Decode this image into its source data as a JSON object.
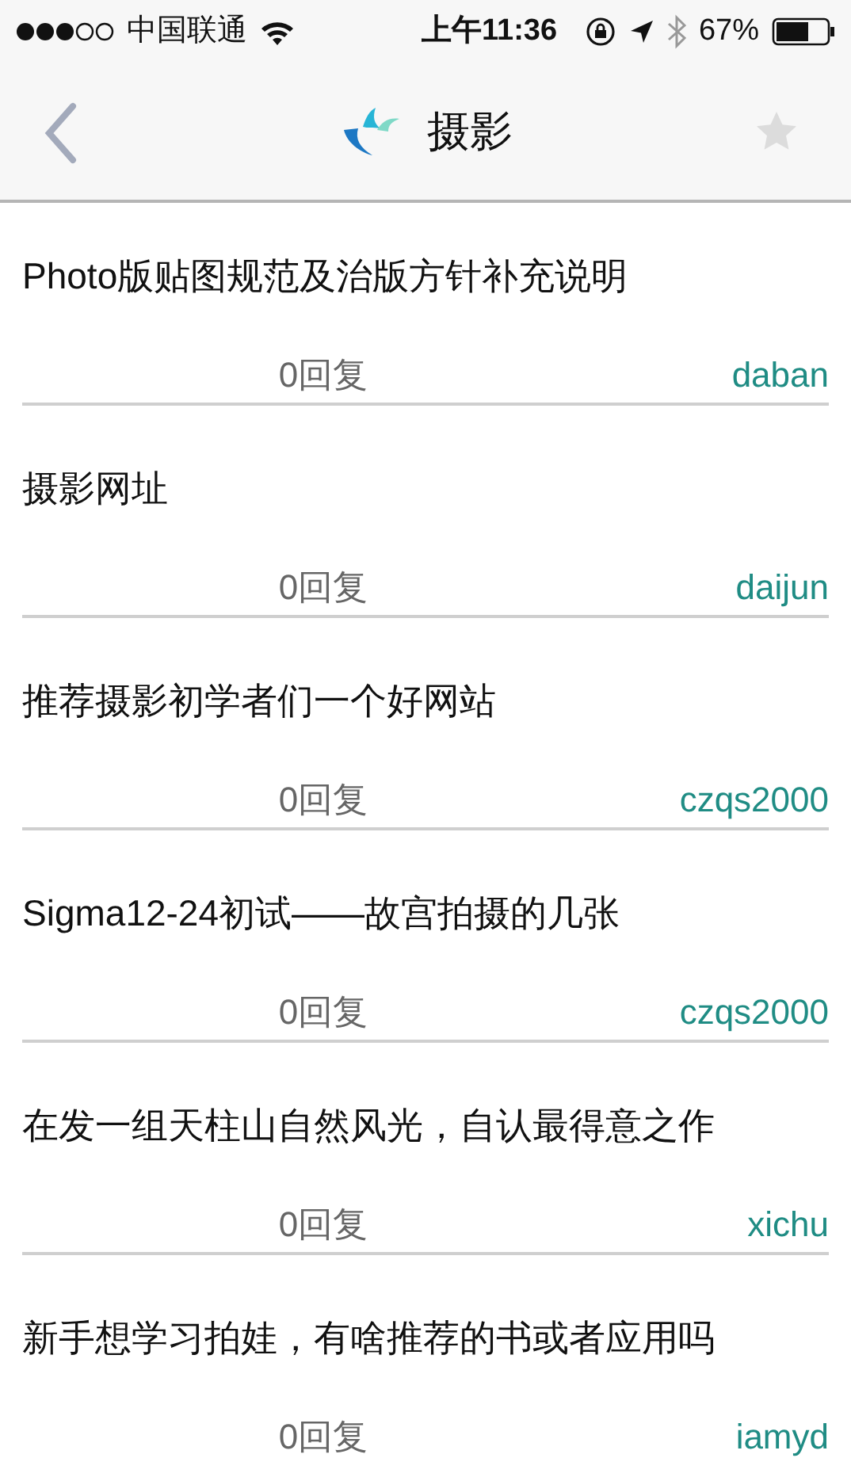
{
  "status_bar": {
    "carrier": "中国联通",
    "time": "上午11:36",
    "battery": "67%"
  },
  "nav": {
    "title": "摄影",
    "favorite": false
  },
  "posts": [
    {
      "title": "Photo版贴图规范及治版方针补充说明",
      "replies": "0回复",
      "author": "daban"
    },
    {
      "title": "摄影网址",
      "replies": "0回复",
      "author": "daijun"
    },
    {
      "title": "推荐摄影初学者们一个好网站",
      "replies": "0回复",
      "author": "czqs2000"
    },
    {
      "title": "Sigma12-24初试——故宫拍摄的几张",
      "replies": "0回复",
      "author": "czqs2000"
    },
    {
      "title": "在发一组天柱山自然风光，自认最得意之作",
      "replies": "0回复",
      "author": "xichu"
    },
    {
      "title": "新手想学习拍娃，有啥推荐的书或者应用吗",
      "replies": "0回复",
      "author": "iamyd"
    }
  ]
}
